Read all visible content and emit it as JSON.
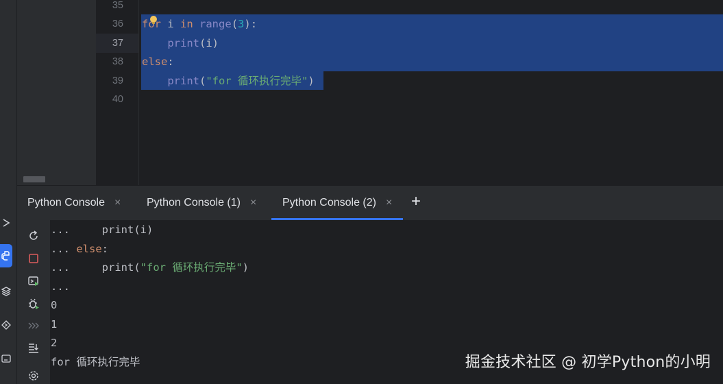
{
  "editor": {
    "line_numbers": [
      "35",
      "36",
      "37",
      "38",
      "39",
      "40"
    ],
    "current_line": "37"
  },
  "code": {
    "line36": {
      "kw_for": "for",
      "var": " i ",
      "kw_in": "in",
      "sp": " ",
      "builtin": "range",
      "open": "(",
      "num": "3",
      "close": "):"
    },
    "line37": {
      "indent": "    ",
      "builtin": "print",
      "rest": "(i)"
    },
    "line38": {
      "kw_else": "else",
      "colon": ":"
    },
    "line39": {
      "indent": "    ",
      "builtin": "print",
      "open": "(",
      "str": "\"for 循环执行完毕\"",
      "close": ")"
    }
  },
  "tabs": [
    {
      "label": "Python Console",
      "close": "×"
    },
    {
      "label": "Python Console (1)",
      "close": "×"
    },
    {
      "label": "Python Console (2)",
      "close": "×"
    }
  ],
  "tab_add": "+",
  "console": {
    "line1": {
      "prompt": "...",
      "gap": "     ",
      "code": "print(i)"
    },
    "line2": {
      "prompt": "...",
      "sp": " ",
      "kw": "else",
      "colon": ":"
    },
    "line3": {
      "prompt": "...",
      "gap": "     ",
      "fn": "print(",
      "str": "\"for 循环执行完毕\"",
      "close": ")"
    },
    "line4": {
      "prompt": "..."
    },
    "out": [
      "0",
      "1",
      "2",
      "for 循环执行完毕"
    ]
  },
  "watermark": "掘金技术社区 @ 初学Python的小明",
  "colors": {
    "selection": "#214283",
    "keyword": "#cf8e6d",
    "string": "#6aab73",
    "number": "#2aacb8",
    "accent": "#3574f0",
    "stop_red": "#db5c5c"
  },
  "icons": {
    "activity": [
      "run-icon",
      "python-console-icon",
      "layers-icon",
      "services-icon",
      "terminal-icon"
    ],
    "console_tools": [
      "rerun-icon",
      "stop-icon",
      "console-run-icon",
      "debug-icon",
      "history-icon",
      "scroll-to-end-icon",
      "settings-icon"
    ]
  }
}
